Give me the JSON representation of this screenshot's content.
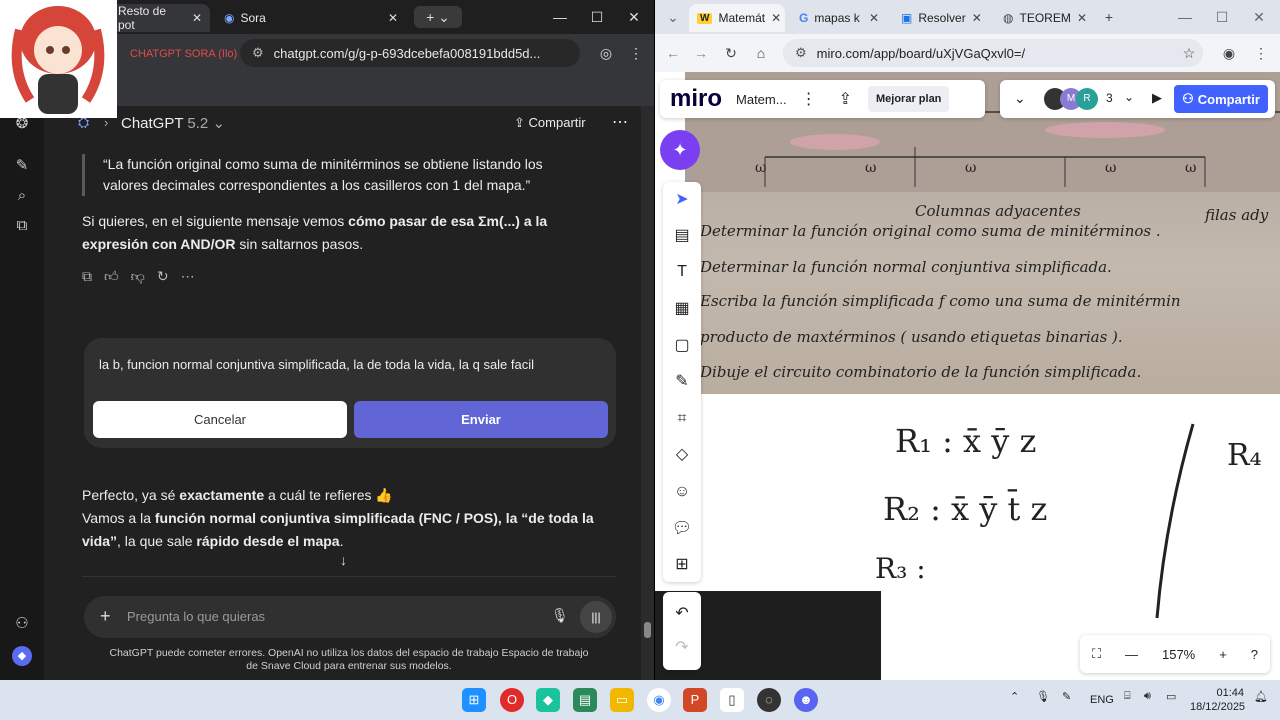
{
  "left": {
    "tabs": [
      {
        "label": "Resto de pot"
      },
      {
        "label": "Sora"
      }
    ],
    "url": "chatgpt.com/g/g-p-693dcebefa008191bdd5d...",
    "bookmark_label": "CHATGPT SORA (Ilo)",
    "header": {
      "model": "ChatGPT",
      "version": "5.2",
      "share": "Compartir"
    },
    "quote": "“La función original como suma de minitérminos se obtiene listando los valores decimales correspondientes a los casilleros con 1 del mapa.”",
    "para1_a": "Si quieres, en el siguiente mensaje vemos ",
    "para1_b": "cómo pasar de esa Σm(...) a la expresión con AND/OR",
    "para1_c": " sin saltarnos pasos.",
    "edit_text": "la b, funcion normal conjuntiva simplificada, la de toda la vida, la q sale facil",
    "cancel": "Cancelar",
    "send": "Enviar",
    "reply1_a": "Perfecto, ya sé ",
    "reply1_b": "exactamente",
    "reply1_c": " a cuál te refieres 👍",
    "reply2_a": "Vamos a la ",
    "reply2_b": "función normal conjuntiva simplificada (FNC / POS), la “de toda la vida”",
    "reply2_c": ", la que sale ",
    "reply2_d": "rápido desde el mapa",
    "reply2_e": ".",
    "composer_placeholder": "Pregunta lo que quieras",
    "footer": "ChatGPT puede cometer errores. OpenAI no utiliza los datos del espacio de trabajo Espacio de trabajo de Snave Cloud para entrenar sus modelos."
  },
  "right": {
    "tabs": [
      {
        "label": "Matemát"
      },
      {
        "label": "mapas k"
      },
      {
        "label": "Resolver"
      },
      {
        "label": "TEOREM"
      }
    ],
    "url": "miro.com/app/board/uXjVGaQxvl0=/",
    "board_name": "Matem...",
    "upgrade": "Mejorar plan",
    "collab_count": "3",
    "share": "Compartir",
    "photo_lines": [
      "Columnas adyacentes",
      "filas ady",
      "Determinar la función original como suma de minitérminos .",
      "Determinar la función normal conjuntiva simplificada.",
      "Escriba la función simplificada f como una suma de minitérmin",
      "producto de maxtérminos ( usando etiquetas binarias ).",
      "Dibuje el circuito combinatorio de la función simplificada."
    ],
    "zoom": "157%",
    "handwriting": {
      "r1": "R₁ :  x̄ ȳ z",
      "r2": "R₂ :  x̄ ȳ t̄ z",
      "r3": "R₃ :",
      "r4": "R₄"
    }
  },
  "taskbar": {
    "lang": "ENG",
    "time": "01:44",
    "date": "18/12/2025"
  }
}
